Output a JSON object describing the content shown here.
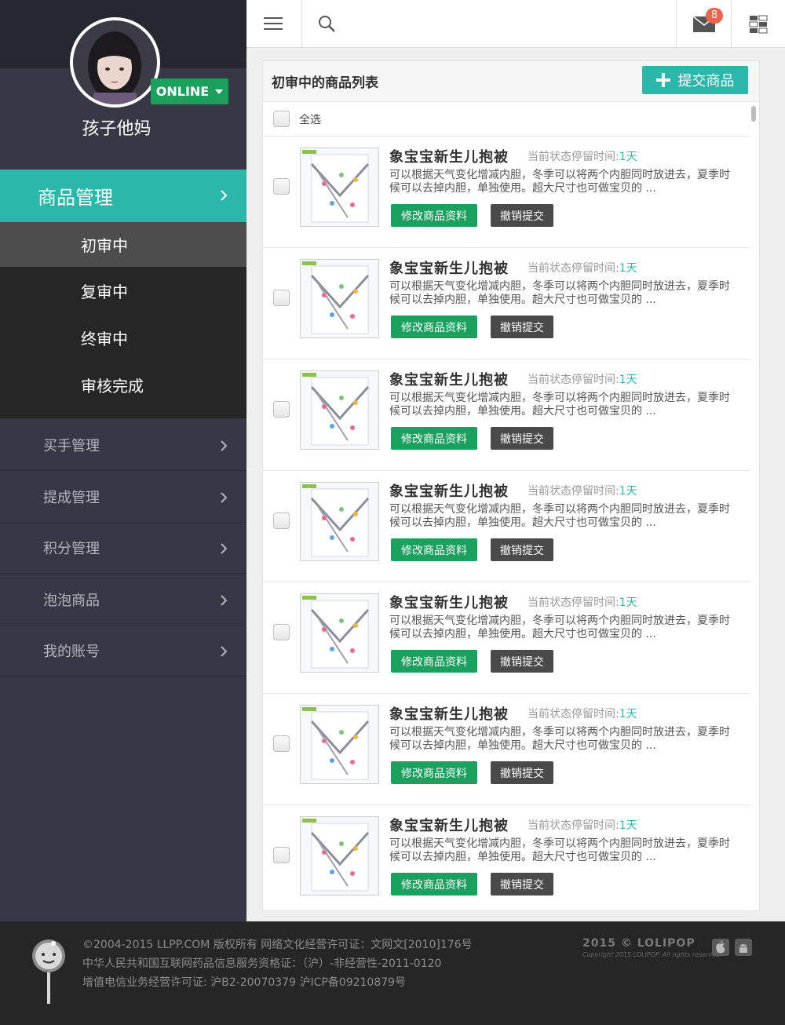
{
  "sidebar": {
    "username": "孩子他妈",
    "status": "ONLINE",
    "active_section": "商品管理",
    "sub_items": [
      "初审中",
      "复审中",
      "终审中",
      "审核完成"
    ],
    "nav_items": [
      "买手管理",
      "提成管理",
      "积分管理",
      "泡泡商品",
      "我的账号"
    ]
  },
  "header": {
    "mail_count": "8"
  },
  "panel": {
    "title": "初审中的商品列表",
    "submit_label": "提交商品",
    "select_all": "全选",
    "items": [
      {
        "title": "象宝宝新生儿抱被",
        "status_label": "当前状态停留时间:",
        "days": "1天",
        "desc": "可以根据天气变化增减内胆，冬季可以将两个内胆同时放进去，夏季时候可以去掉内胆，单独使用。超大尺寸也可做宝贝的 ...",
        "edit_label": "修改商品资料",
        "cancel_label": "撤销提交"
      },
      {
        "title": "象宝宝新生儿抱被",
        "status_label": "当前状态停留时间:",
        "days": "1天",
        "desc": "可以根据天气变化增减内胆，冬季可以将两个内胆同时放进去，夏季时候可以去掉内胆，单独使用。超大尺寸也可做宝贝的 ...",
        "edit_label": "修改商品资料",
        "cancel_label": "撤销提交"
      },
      {
        "title": "象宝宝新生儿抱被",
        "status_label": "当前状态停留时间:",
        "days": "1天",
        "desc": "可以根据天气变化增减内胆，冬季可以将两个内胆同时放进去，夏季时候可以去掉内胆，单独使用。超大尺寸也可做宝贝的 ...",
        "edit_label": "修改商品资料",
        "cancel_label": "撤销提交"
      },
      {
        "title": "象宝宝新生儿抱被",
        "status_label": "当前状态停留时间:",
        "days": "1天",
        "desc": "可以根据天气变化增减内胆，冬季可以将两个内胆同时放进去，夏季时候可以去掉内胆，单独使用。超大尺寸也可做宝贝的 ...",
        "edit_label": "修改商品资料",
        "cancel_label": "撤销提交"
      },
      {
        "title": "象宝宝新生儿抱被",
        "status_label": "当前状态停留时间:",
        "days": "1天",
        "desc": "可以根据天气变化增减内胆，冬季可以将两个内胆同时放进去，夏季时候可以去掉内胆，单独使用。超大尺寸也可做宝贝的 ...",
        "edit_label": "修改商品资料",
        "cancel_label": "撤销提交"
      },
      {
        "title": "象宝宝新生儿抱被",
        "status_label": "当前状态停留时间:",
        "days": "1天",
        "desc": "可以根据天气变化增减内胆，冬季可以将两个内胆同时放进去，夏季时候可以去掉内胆，单独使用。超大尺寸也可做宝贝的 ...",
        "edit_label": "修改商品资料",
        "cancel_label": "撤销提交"
      },
      {
        "title": "象宝宝新生儿抱被",
        "status_label": "当前状态停留时间:",
        "days": "1天",
        "desc": "可以根据天气变化增减内胆，冬季可以将两个内胆同时放进去，夏季时候可以去掉内胆，单独使用。超大尺寸也可做宝贝的 ...",
        "edit_label": "修改商品资料",
        "cancel_label": "撤销提交"
      }
    ]
  },
  "footer": {
    "lines": [
      "©2004-2015 LLPP.COM 版权所有 网络文化经营许可证：文网文[2010]176号",
      "中华人民共和国互联网药品信息服务资格证：（沪）-非经营性-2011-0120",
      "增值电信业务经营许可证: 沪B2-20070379 沪ICP备09210879号"
    ],
    "brand": "2015 © LOLIPOP",
    "brand_sub": "Copyright 2015 LOLIPOP. All rights reserved."
  },
  "colors": {
    "accent": "#2bb8ab",
    "green": "#1aa15e",
    "sidebar": "#363945",
    "badge": "#f0624b"
  },
  "icons": [
    "menu-icon",
    "search-icon",
    "mail-icon",
    "grid-icon",
    "chevron-right-icon",
    "plus-icon"
  ]
}
